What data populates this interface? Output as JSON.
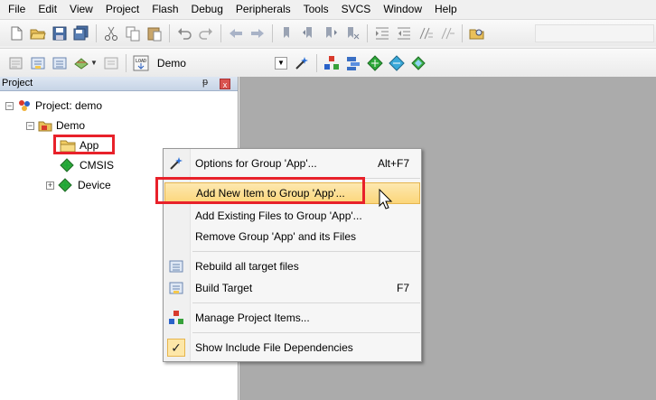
{
  "menubar": {
    "items": [
      "File",
      "Edit",
      "View",
      "Project",
      "Flash",
      "Debug",
      "Peripherals",
      "Tools",
      "SVCS",
      "Window",
      "Help"
    ]
  },
  "toolbar1": {
    "icons": [
      "new-file-icon",
      "open-folder-icon",
      "save-icon",
      "save-all-icon",
      "cut-icon",
      "copy-icon",
      "paste-icon",
      "undo-icon",
      "redo-icon",
      "nav-back-icon",
      "nav-forward-icon",
      "bookmark-icon",
      "bookmark-prev-icon",
      "bookmark-next-icon",
      "bookmark-clear-icon",
      "indent-icon",
      "unindent-icon",
      "comment-icon",
      "uncomment-icon",
      "find-in-files-icon"
    ]
  },
  "toolbar2": {
    "target_name": "Demo",
    "icons": [
      "translate-icon",
      "build-icon",
      "rebuild-icon",
      "batch-build-icon",
      "stop-build-icon",
      "download-icon",
      "target-options-icon",
      "manage-items-icon",
      "pack-installer-icon",
      "select-packs-icon",
      "manage-rte-icon"
    ],
    "load_text": "LOAD"
  },
  "project_panel": {
    "title": "Project",
    "pin_glyph": "ᵽ",
    "close_glyph": "x",
    "tree": {
      "root": "Project: demo",
      "target": "Demo",
      "groups": [
        "App",
        "CMSIS",
        "Device"
      ],
      "collapse_glyph": "−",
      "expand_glyph": "+"
    }
  },
  "context_menu": {
    "items": [
      {
        "label": "Options for Group 'App'...",
        "shortcut": "Alt+F7",
        "icon": "options-wand-icon"
      },
      {
        "label": "Add New  Item to Group 'App'...",
        "shortcut": "",
        "icon": "",
        "highlighted": true
      },
      {
        "label": "Add Existing Files to Group 'App'...",
        "shortcut": "",
        "icon": ""
      },
      {
        "label": "Remove Group 'App' and its Files",
        "shortcut": "",
        "icon": ""
      },
      {
        "label": "Rebuild all target files",
        "shortcut": "",
        "icon": "rebuild-icon"
      },
      {
        "label": "Build Target",
        "shortcut": "F7",
        "icon": "build-icon"
      },
      {
        "label": "Manage Project Items...",
        "shortcut": "",
        "icon": "manage-items-icon"
      },
      {
        "label": "Show Include File Dependencies",
        "shortcut": "",
        "icon": "checkmark-icon",
        "checked": true
      }
    ],
    "check_glyph": "✓"
  },
  "colors": {
    "highlight_box": "#e8212a",
    "menu_highlight": "#fbd67a",
    "editor_bg": "#ababab"
  }
}
